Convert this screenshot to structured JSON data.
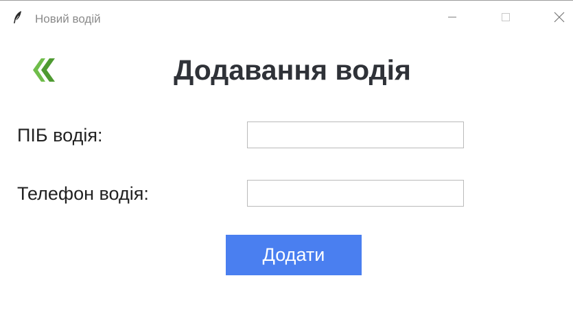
{
  "window": {
    "title": "Новий водій",
    "icons": {
      "app": "feather-icon",
      "minimize": "minimize-icon",
      "maximize": "maximize-icon",
      "close": "close-icon"
    }
  },
  "header": {
    "back_icon": "double-chevron-left-icon",
    "back_color": "#5aa83a",
    "title": "Додавання водія"
  },
  "form": {
    "name_label": "ПІБ водія:",
    "name_value": "",
    "phone_label": "Телефон водія:",
    "phone_value": "",
    "submit_label": "Додати",
    "submit_color": "#4a7ff0"
  }
}
